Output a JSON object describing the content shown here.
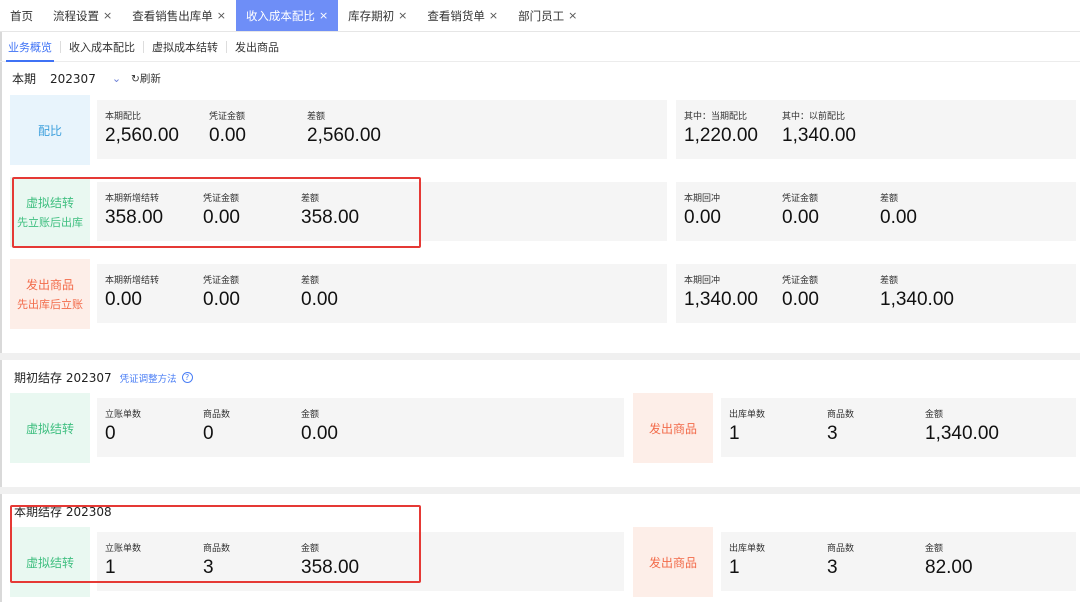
{
  "tabs": [
    {
      "label": "首页",
      "closable": false
    },
    {
      "label": "流程设置",
      "closable": true
    },
    {
      "label": "查看销售出库单",
      "closable": true
    },
    {
      "label": "收入成本配比",
      "closable": true,
      "active": true
    },
    {
      "label": "库存期初",
      "closable": true
    },
    {
      "label": "查看销货单",
      "closable": true
    },
    {
      "label": "部门员工",
      "closable": true
    }
  ],
  "close_glyph": "×",
  "subtabs": [
    "业务概览",
    "收入成本配比",
    "虚拟成本结转",
    "发出商品"
  ],
  "period": {
    "label": "本期",
    "value": "202307",
    "refresh": "刷新"
  },
  "peibi": {
    "label": "配比",
    "left": [
      {
        "label": "本期配比",
        "value": "2,560.00"
      },
      {
        "label": "凭证金额",
        "value": "0.00"
      },
      {
        "label": "差额",
        "value": "2,560.00"
      }
    ],
    "right": [
      {
        "label": "其中：当期配比",
        "value": "1,220.00"
      },
      {
        "label": "其中：以前配比",
        "value": "1,340.00"
      }
    ]
  },
  "virtual": {
    "label": "虚拟结转",
    "sub": "先立账后出库",
    "left": [
      {
        "label": "本期新增结转",
        "value": "358.00"
      },
      {
        "label": "凭证金额",
        "value": "0.00"
      },
      {
        "label": "差额",
        "value": "358.00"
      }
    ],
    "right": [
      {
        "label": "本期回冲",
        "value": "0.00"
      },
      {
        "label": "凭证金额",
        "value": "0.00"
      },
      {
        "label": "差额",
        "value": "0.00"
      }
    ]
  },
  "shipped": {
    "label": "发出商品",
    "sub": "先出库后立账",
    "left": [
      {
        "label": "本期新增结转",
        "value": "0.00"
      },
      {
        "label": "凭证金额",
        "value": "0.00"
      },
      {
        "label": "差额",
        "value": "0.00"
      }
    ],
    "right": [
      {
        "label": "本期回冲",
        "value": "1,340.00"
      },
      {
        "label": "凭证金额",
        "value": "0.00"
      },
      {
        "label": "差额",
        "value": "1,340.00"
      }
    ]
  },
  "opening": {
    "title": "期初结存",
    "period": "202307",
    "link": "凭证调整方法",
    "help": "?",
    "virtual": {
      "label": "虚拟结转",
      "items": [
        {
          "label": "立账单数",
          "value": "0"
        },
        {
          "label": "商品数",
          "value": "0"
        },
        {
          "label": "金额",
          "value": "0.00"
        }
      ]
    },
    "shipped": {
      "label": "发出商品",
      "items": [
        {
          "label": "出库单数",
          "value": "1"
        },
        {
          "label": "商品数",
          "value": "3"
        },
        {
          "label": "金额",
          "value": "1,340.00"
        }
      ]
    }
  },
  "closing": {
    "title": "本期结存",
    "period": "202308",
    "virtual": {
      "label": "虚拟结转",
      "items": [
        {
          "label": "立账单数",
          "value": "1"
        },
        {
          "label": "商品数",
          "value": "3"
        },
        {
          "label": "金额",
          "value": "358.00"
        }
      ]
    },
    "shipped": {
      "label": "发出商品",
      "items": [
        {
          "label": "出库单数",
          "value": "1"
        },
        {
          "label": "商品数",
          "value": "3"
        },
        {
          "label": "金额",
          "value": "82.00"
        }
      ]
    }
  },
  "colors": {
    "accent": "#6e8ef7",
    "highlight": "#e53935",
    "green": "#3fbf80",
    "orange": "#f26b4a",
    "blue": "#3ea0dd"
  }
}
